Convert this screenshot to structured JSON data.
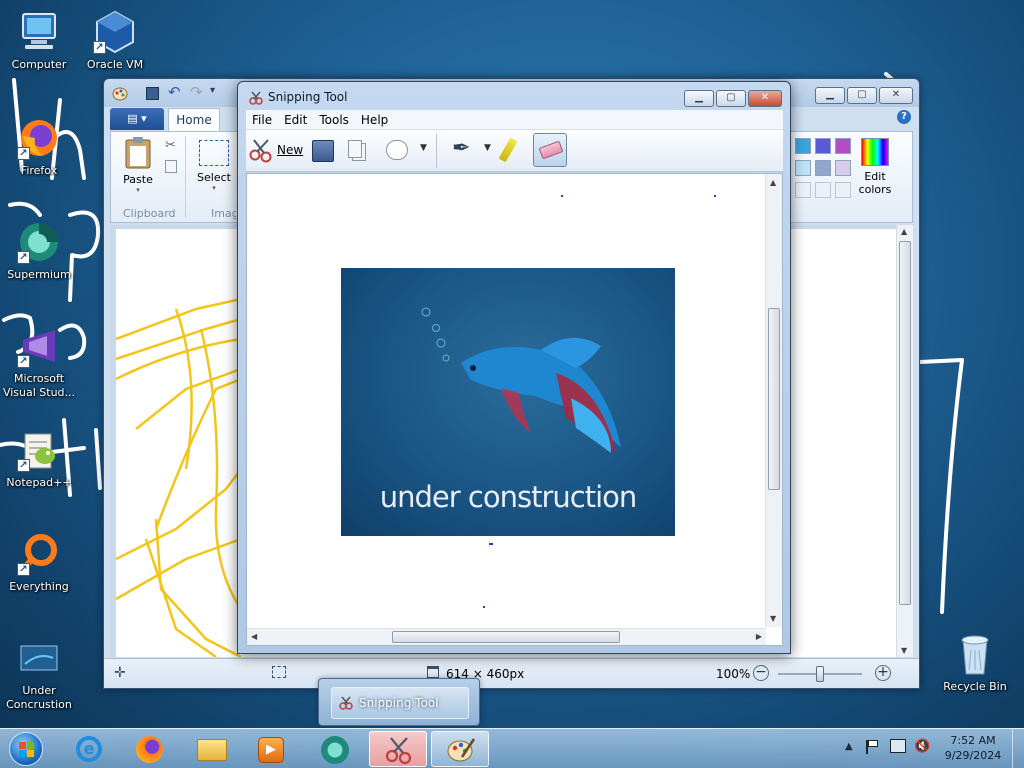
{
  "desktop": {
    "icons": [
      {
        "label": "Computer"
      },
      {
        "label": "Oracle VM VirtualBox"
      },
      {
        "label": "Firefox"
      },
      {
        "label": "Supermium"
      },
      {
        "label": "Microsoft Visual Stud..."
      },
      {
        "label": "Notepad++"
      },
      {
        "label": "Everything"
      },
      {
        "label": "Under Concrustion"
      },
      {
        "label": "Recycle Bin"
      }
    ]
  },
  "paint": {
    "tabs": {
      "menu": "▤ ▾",
      "home": "Home"
    },
    "groups": {
      "clipboard": "Clipboard",
      "image": "Image"
    },
    "buttons": {
      "paste": "Paste",
      "select": "Select",
      "edit_colors": "Edit colors"
    },
    "status": {
      "size": "614 × 460px",
      "zoom": "100%"
    },
    "palette_colors": [
      "#3aa3e0",
      "#5a5ad6",
      "#b44cc4",
      "#bde3f5",
      "#8fa7cf",
      "#d6cde8",
      "#eaf2f8",
      "#eaf2f8",
      "#eaf2f8"
    ]
  },
  "snipping_tool": {
    "title": "Snipping Tool",
    "menu": [
      "File",
      "Edit",
      "Tools",
      "Help"
    ],
    "toolbar": {
      "new_label": "New"
    },
    "image_caption": "under construction"
  },
  "taskbar": {
    "preview_label": "Snipping Tool",
    "time": "7:52 AM",
    "date": "9/29/2024"
  }
}
